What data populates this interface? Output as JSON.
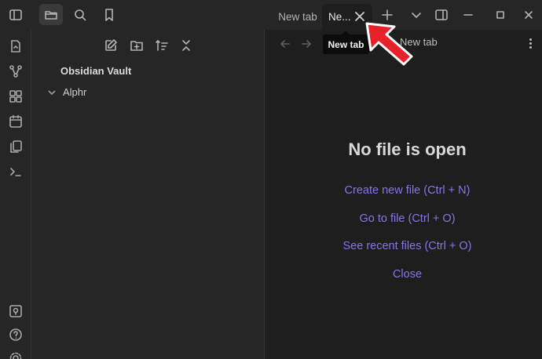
{
  "titlebar": {
    "buttons": [
      {
        "name": "sidebar-toggle-icon"
      },
      {
        "name": "files-icon",
        "active": true
      },
      {
        "name": "search-icon"
      },
      {
        "name": "bookmark-icon"
      }
    ],
    "tabs": [
      {
        "label": "New tab",
        "active": false
      },
      {
        "label": "New tab",
        "display": "Ne...",
        "active": true
      }
    ],
    "right_buttons": [
      "new-tab-plus-icon",
      "tab-list-chevron-icon",
      "right-sidebar-icon",
      "minimize-icon",
      "maximize-icon",
      "close-window-icon"
    ]
  },
  "ribbon": {
    "top_icons": [
      "switcher-icon",
      "graph-view-icon",
      "canvas-icon",
      "daily-note-icon",
      "templates-icon",
      "command-palette-icon"
    ],
    "bottom_icons": [
      "vault-switcher-icon",
      "help-icon",
      "settings-icon"
    ]
  },
  "sidebar": {
    "nav_icons": [
      "new-note-icon",
      "new-folder-icon",
      "sort-icon",
      "collapse-all-icon"
    ],
    "vault_name": "Obsidian Vault",
    "folders": [
      {
        "name": "Alphr"
      }
    ]
  },
  "main": {
    "title": "New tab",
    "empty_state": {
      "heading": "No file is open",
      "links": [
        "Create new file (Ctrl + N)",
        "Go to file (Ctrl + O)",
        "See recent files (Ctrl + O)",
        "Close"
      ]
    }
  },
  "tooltip": {
    "text": "New tab"
  },
  "colors": {
    "accent": "#8a74e6",
    "annotation_arrow": "#e8202a",
    "background": "#1e1e1e",
    "sidebar": "#262626"
  }
}
